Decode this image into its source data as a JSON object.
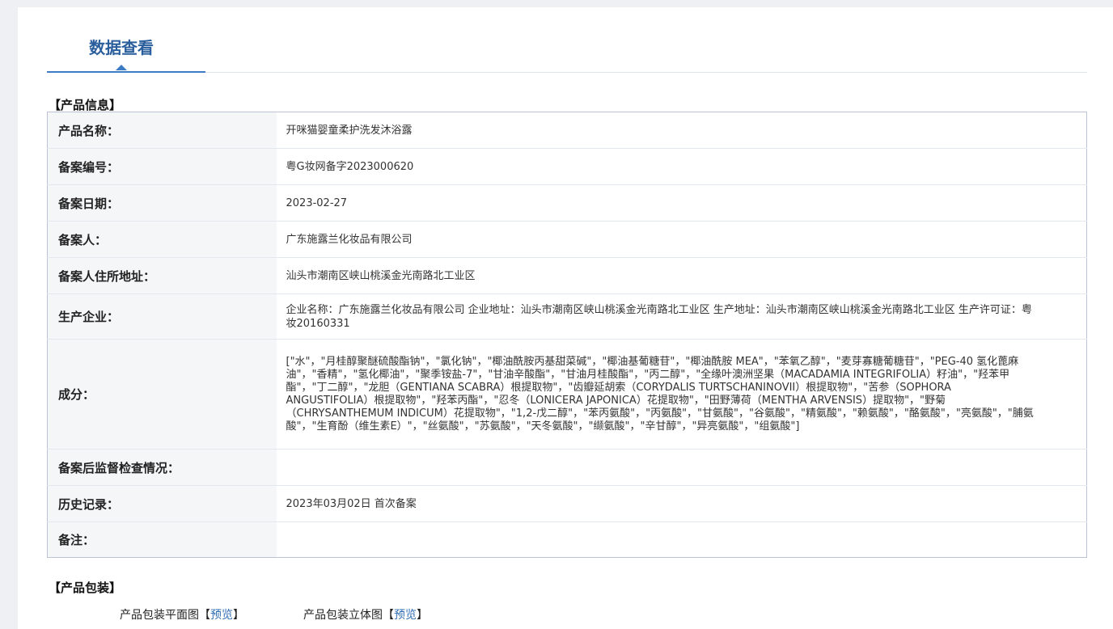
{
  "tab": {
    "label": "数据查看"
  },
  "sections": {
    "product_info": "【产品信息】",
    "product_packaging": "【产品包装】"
  },
  "info_rows": [
    {
      "label": "产品名称：",
      "value": "开咪猫婴童柔护洗发沐浴露"
    },
    {
      "label": "备案编号：",
      "value": "粤G妆网备字2023000620"
    },
    {
      "label": "备案日期：",
      "value": "2023-02-27"
    },
    {
      "label": "备案人：",
      "value": "广东施露兰化妆品有限公司"
    },
    {
      "label": "备案人住所地址：",
      "value": "汕头市潮南区峡山桃溪金光南路北工业区"
    },
    {
      "label": "生产企业：",
      "value": "企业名称：广东施露兰化妆品有限公司 企业地址：汕头市潮南区峡山桃溪金光南路北工业区 生产地址：汕头市潮南区峡山桃溪金光南路北工业区 生产许可证：粤妆20160331"
    },
    {
      "label": "成分：",
      "value": "[\"水\"，\"月桂醇聚醚硫酸酯钠\"，\"氯化钠\"，\"椰油酰胺丙基甜菜碱\"，\"椰油基葡糖苷\"，\"椰油酰胺 MEA\"，\"苯氧乙醇\"，\"麦芽寡糖葡糖苷\"，\"PEG-40 氢化蓖麻油\"，\"香精\"，\"氢化椰油\"，\"聚季铵盐-7\"，\"甘油辛酸酯\"，\"甘油月桂酸酯\"，\"丙二醇\"，\"全缘叶澳洲坚果（MACADAMIA INTEGRIFOLIA）籽油\"，\"羟苯甲酯\"，\"丁二醇\"，\"龙胆（GENTIANA SCABRA）根提取物\"，\"齿瓣延胡索（CORYDALIS TURTSCHANINOVII）根提取物\"，\"苦参（SOPHORA ANGUSTIFOLIA）根提取物\"，\"羟苯丙酯\"，\"忍冬（LONICERA JAPONICA）花提取物\"，\"田野薄荷（MENTHA ARVENSIS）提取物\"，\"野菊（CHRYSANTHEMUM INDICUM）花提取物\"，\"1,2-戊二醇\"，\"苯丙氨酸\"，\"丙氨酸\"，\"甘氨酸\"，\"谷氨酸\"，\"精氨酸\"，\"赖氨酸\"，\"酪氨酸\"，\"亮氨酸\"，\"脯氨酸\"，\"生育酚（维生素E）\"，\"丝氨酸\"，\"苏氨酸\"，\"天冬氨酸\"，\"缬氨酸\"，\"辛甘醇\"，\"异亮氨酸\"，\"组氨酸\"]"
    },
    {
      "label": "备案后监督检查情况：",
      "value": ""
    },
    {
      "label": "历史记录：",
      "value": "2023年03月02日 首次备案"
    },
    {
      "label": "备注：",
      "value": ""
    }
  ],
  "packaging": {
    "flat_label": "产品包装平面图",
    "threed_label": "产品包装立体图",
    "bracket_open": "【",
    "bracket_close": "】",
    "preview_label": "预览"
  }
}
